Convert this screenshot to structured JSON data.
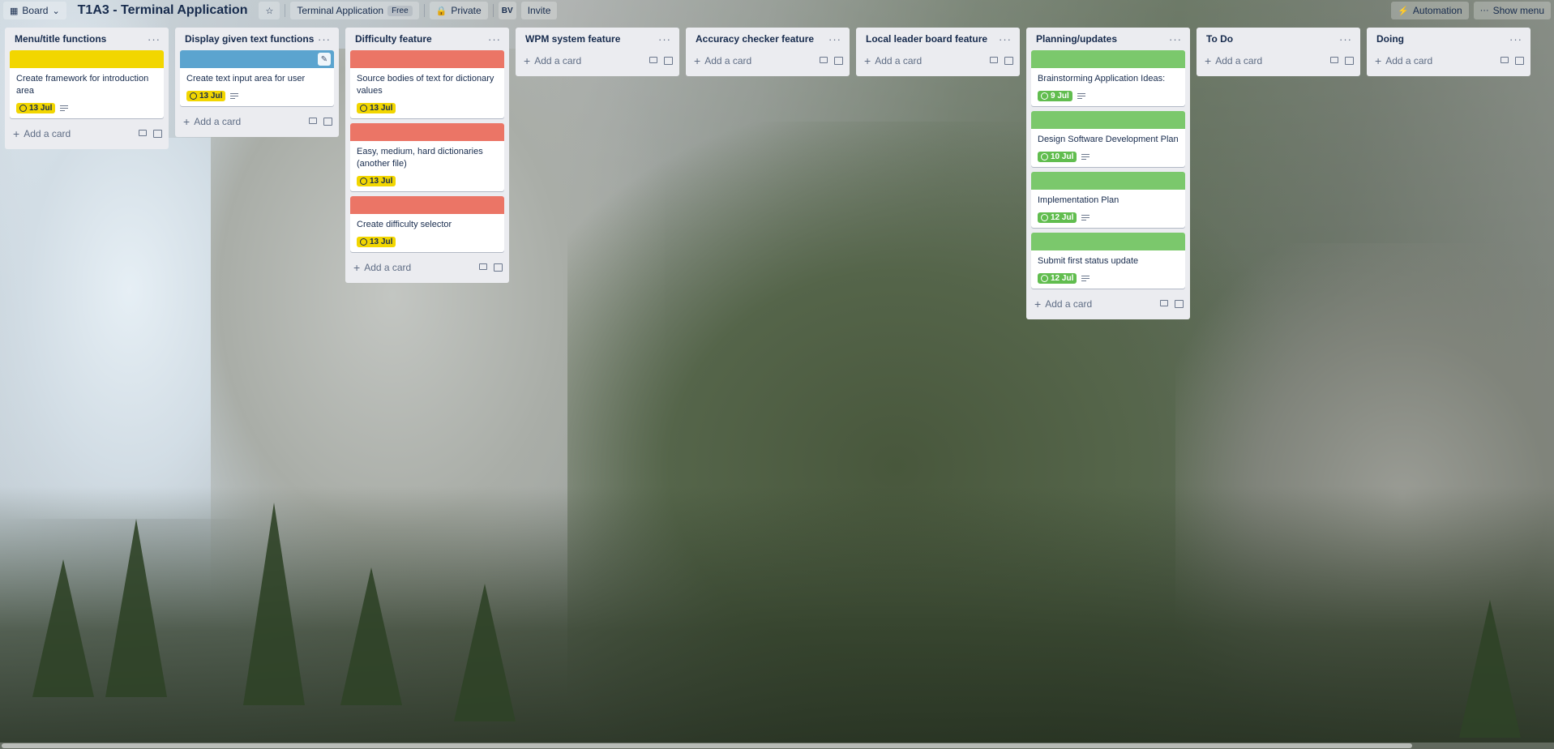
{
  "header": {
    "board_view": "Board",
    "title": "T1A3 - Terminal Application",
    "workspace": "Terminal Application",
    "workspace_badge": "Free",
    "visibility": "Private",
    "member_initials": "BV",
    "invite": "Invite",
    "automation": "Automation",
    "show_menu": "Show menu"
  },
  "add_card_label": "Add a card",
  "lists": [
    {
      "title": "Menu/title functions",
      "cards": [
        {
          "title": "Create framework for introduction area",
          "cover": "#f2d600",
          "due": "13 Jul",
          "due_color": "yellow",
          "has_description": true
        }
      ]
    },
    {
      "title": "Display given text functions",
      "cards": [
        {
          "title": "Create text input area for user",
          "cover": "#5ba4cf",
          "due": "13 Jul",
          "due_color": "yellow",
          "has_description": true
        }
      ]
    },
    {
      "title": "Difficulty feature",
      "cards": [
        {
          "title": "Source bodies of text for dictionary values",
          "cover": "#eb7566",
          "due": "13 Jul",
          "due_color": "yellow",
          "has_description": false
        },
        {
          "title": "Easy, medium, hard dictionaries (another file)",
          "cover": "#eb7566",
          "due": "13 Jul",
          "due_color": "yellow",
          "has_description": false
        },
        {
          "title": "Create difficulty selector",
          "cover": "#eb7566",
          "due": "13 Jul",
          "due_color": "yellow",
          "has_description": false
        }
      ]
    },
    {
      "title": "WPM system feature",
      "cards": []
    },
    {
      "title": "Accuracy checker feature",
      "cards": []
    },
    {
      "title": "Local leader board feature",
      "cards": []
    },
    {
      "title": "Planning/updates",
      "cards": [
        {
          "title": "Brainstorming Application Ideas:",
          "cover": "#7bc86c",
          "due": "9 Jul",
          "due_color": "green",
          "has_description": true
        },
        {
          "title": "Design Software Development Plan",
          "cover": "#7bc86c",
          "due": "10 Jul",
          "due_color": "green",
          "has_description": true
        },
        {
          "title": "Implementation Plan",
          "cover": "#7bc86c",
          "due": "12 Jul",
          "due_color": "green",
          "has_description": true
        },
        {
          "title": "Submit first status update",
          "cover": "#7bc86c",
          "due": "12 Jul",
          "due_color": "green",
          "has_description": true
        }
      ]
    },
    {
      "title": "To Do",
      "cards": []
    },
    {
      "title": "Doing",
      "cards": []
    }
  ]
}
